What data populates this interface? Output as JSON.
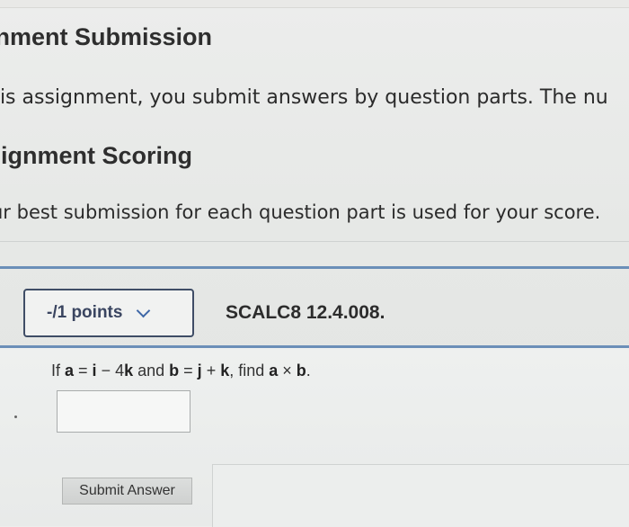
{
  "header": {
    "title": "gnment Submission",
    "description": "his assignment, you submit answers by question parts. The nu"
  },
  "scoring": {
    "title": "signment Scoring",
    "description": "ur best submission for each question part is used for your score."
  },
  "question": {
    "points_label": "-/1 points",
    "question_id": "SCALC8 12.4.008.",
    "text_if": "If ",
    "a": "a",
    "eq1": " = ",
    "i": "i",
    "minus": " − 4",
    "k1": "k",
    "and": " and ",
    "b": "b",
    "eq2": " = ",
    "j": "j",
    "plus": " + ",
    "k2": "k",
    "find": ", find ",
    "a2": "a",
    "times": " × ",
    "b2": "b",
    "period": ".",
    "answer_value": ""
  },
  "actions": {
    "submit_label": "Submit Answer"
  },
  "colors": {
    "accent_rule": "#6b8fb8",
    "points_text": "#3a4560",
    "chevron": "#3e67a7"
  },
  "icons": {
    "points_dropdown": "chevron-down-icon"
  }
}
